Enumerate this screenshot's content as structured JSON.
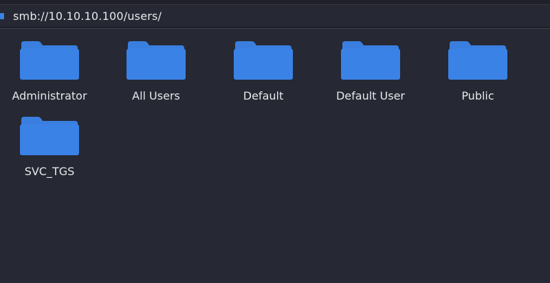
{
  "location": {
    "path": "smb://10.10.10.100/users/"
  },
  "colors": {
    "background": "#262833",
    "folder": "#3b82e6",
    "folder_tab": "#3a7fe0",
    "text": "#e7e8ec"
  },
  "items": [
    {
      "label": "Administrator",
      "icon": "folder-icon"
    },
    {
      "label": "All Users",
      "icon": "folder-icon"
    },
    {
      "label": "Default",
      "icon": "folder-icon"
    },
    {
      "label": "Default User",
      "icon": "folder-icon"
    },
    {
      "label": "Public",
      "icon": "folder-icon"
    },
    {
      "label": "SVC_TGS",
      "icon": "folder-icon"
    }
  ]
}
